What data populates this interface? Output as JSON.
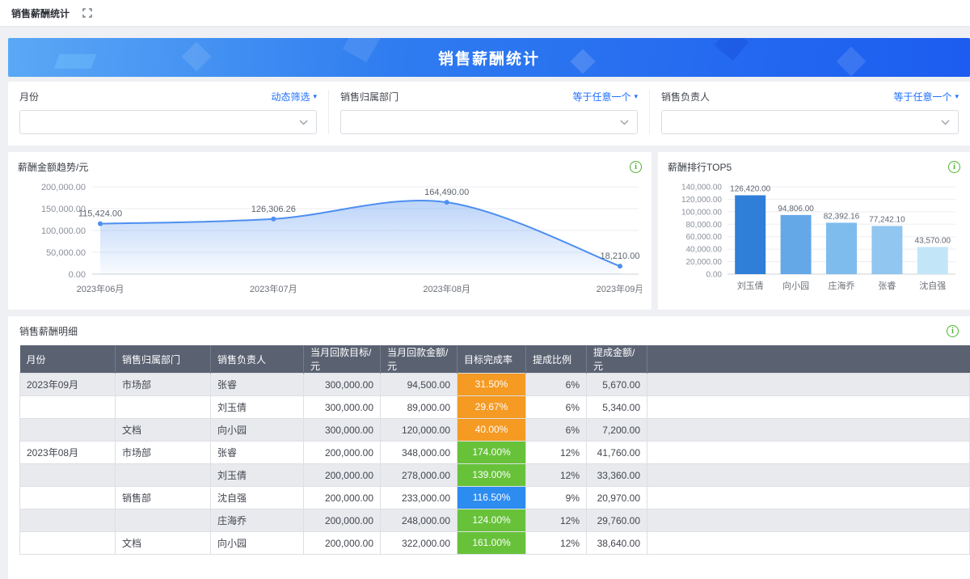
{
  "tabbar": {
    "tab_label": "销售薪酬统计"
  },
  "banner": {
    "title": "销售薪酬统计"
  },
  "filters": [
    {
      "label": "月份",
      "operator": "动态筛选",
      "value": ""
    },
    {
      "label": "销售归属部门",
      "operator": "等于任意一个",
      "value": ""
    },
    {
      "label": "销售负责人",
      "operator": "等于任意一个",
      "value": ""
    }
  ],
  "colors": {
    "accent_blue": "#1e6fff",
    "banner_gradient_start": "#5aa8f5",
    "banner_gradient_end": "#1c5cf0",
    "info_icon_green": "#4db32e",
    "table_header_bg": "#5a6272",
    "stripe_row_bg": "#e8eaee",
    "rate_orange": "#f59a23",
    "rate_green": "#67c23a",
    "rate_blue": "#2d8cf0"
  },
  "chart_data": [
    {
      "type": "area",
      "title": "薪酬金额趋势/元",
      "categories": [
        "2023年06月",
        "2023年07月",
        "2023年08月",
        "2023年09月"
      ],
      "values": [
        115424.0,
        126306.26,
        164490.0,
        18210.0
      ],
      "point_labels": [
        "115,424.00",
        "126,306.26",
        "164,490.00",
        "18,210.00"
      ],
      "xlabel": "",
      "ylabel": "",
      "ylim": [
        0,
        200000
      ],
      "y_tick_step": 50000,
      "y_tick_labels": [
        "0.00",
        "50,000.00",
        "100,000.00",
        "150,000.00",
        "200,000.00"
      ],
      "line_color": "#4e8ff0",
      "grid": true,
      "legend": "none"
    },
    {
      "type": "bar",
      "title": "薪酬排行TOP5",
      "categories": [
        "刘玉倩",
        "向小园",
        "庄海乔",
        "张睿",
        "沈自强"
      ],
      "values": [
        126420.0,
        94806.0,
        82392.16,
        77242.1,
        43570.0
      ],
      "value_labels": [
        "126,420.00",
        "94,806.00",
        "82,392.16",
        "77,242.10",
        "43,570.00"
      ],
      "xlabel": "",
      "ylabel": "",
      "ylim": [
        0,
        140000
      ],
      "y_tick_step": 20000,
      "y_tick_labels": [
        "0.00",
        "20,000.00",
        "40,000.00",
        "60,000.00",
        "80,000.00",
        "100,000.00",
        "120,000.00",
        "140,000.00"
      ],
      "bar_colors": [
        "#2f7ed8",
        "#64a8e8",
        "#7ebcee",
        "#90c6f0",
        "#c2e6f8"
      ],
      "grid": true,
      "legend": "none"
    }
  ],
  "table": {
    "title": "销售薪酬明细",
    "headers": [
      "月份",
      "销售归属部门",
      "销售负责人",
      "当月回款目标/元",
      "当月回款金额/元",
      "目标完成率",
      "提成比例",
      "提成金额/元"
    ],
    "rows": [
      {
        "month": "2023年09月",
        "dept": "市场部",
        "person": "张睿",
        "target": "300,000.00",
        "amount": "94,500.00",
        "rate": "31.50%",
        "rate_color": "#f59a23",
        "ratio": "6%",
        "commission": "5,670.00"
      },
      {
        "month": "",
        "dept": "",
        "person": "刘玉倩",
        "target": "300,000.00",
        "amount": "89,000.00",
        "rate": "29.67%",
        "rate_color": "#f59a23",
        "ratio": "6%",
        "commission": "5,340.00"
      },
      {
        "month": "",
        "dept": "文档",
        "person": "向小园",
        "target": "300,000.00",
        "amount": "120,000.00",
        "rate": "40.00%",
        "rate_color": "#f59a23",
        "ratio": "6%",
        "commission": "7,200.00"
      },
      {
        "month": "2023年08月",
        "dept": "市场部",
        "person": "张睿",
        "target": "200,000.00",
        "amount": "348,000.00",
        "rate": "174.00%",
        "rate_color": "#67c23a",
        "ratio": "12%",
        "commission": "41,760.00"
      },
      {
        "month": "",
        "dept": "",
        "person": "刘玉倩",
        "target": "200,000.00",
        "amount": "278,000.00",
        "rate": "139.00%",
        "rate_color": "#67c23a",
        "ratio": "12%",
        "commission": "33,360.00"
      },
      {
        "month": "",
        "dept": "销售部",
        "person": "沈自强",
        "target": "200,000.00",
        "amount": "233,000.00",
        "rate": "116.50%",
        "rate_color": "#2d8cf0",
        "ratio": "9%",
        "commission": "20,970.00"
      },
      {
        "month": "",
        "dept": "",
        "person": "庄海乔",
        "target": "200,000.00",
        "amount": "248,000.00",
        "rate": "124.00%",
        "rate_color": "#67c23a",
        "ratio": "12%",
        "commission": "29,760.00"
      },
      {
        "month": "",
        "dept": "文档",
        "person": "向小园",
        "target": "200,000.00",
        "amount": "322,000.00",
        "rate": "161.00%",
        "rate_color": "#67c23a",
        "ratio": "12%",
        "commission": "38,640.00"
      }
    ]
  }
}
